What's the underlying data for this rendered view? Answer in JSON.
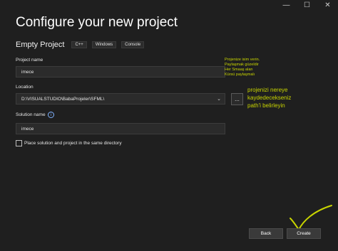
{
  "window": {
    "minimize_glyph": "—",
    "maximize_glyph": "☐",
    "close_glyph": "✕"
  },
  "page": {
    "title": "Configure your new project",
    "template_name": "Empty Project",
    "tags": [
      "C++",
      "Windows",
      "Console"
    ]
  },
  "form": {
    "project_name_label": "Project name",
    "project_name_value": "imece",
    "location_label": "Location",
    "location_value": "D:\\VISUALSTUDIO\\BabaProjeler\\SFML\\",
    "browse_label": "...",
    "solution_name_label": "Solution name",
    "solution_name_value": "imece",
    "info_glyph": "i",
    "place_same_dir_label": "Place solution and project in the same directory",
    "place_same_dir_checked": false
  },
  "annotations": {
    "small_lines": [
      "Projenize isim verin.",
      "Paylaşmak güzeldir",
      "Her Smaaş alan",
      "Kürsü paylaşmalı"
    ],
    "large_lines": [
      "projenizi nereye",
      "kaydedecekseniz",
      "path'i belirleyin"
    ],
    "color": "#c8d400"
  },
  "footer": {
    "back_label": "Back",
    "create_label": "Create"
  }
}
